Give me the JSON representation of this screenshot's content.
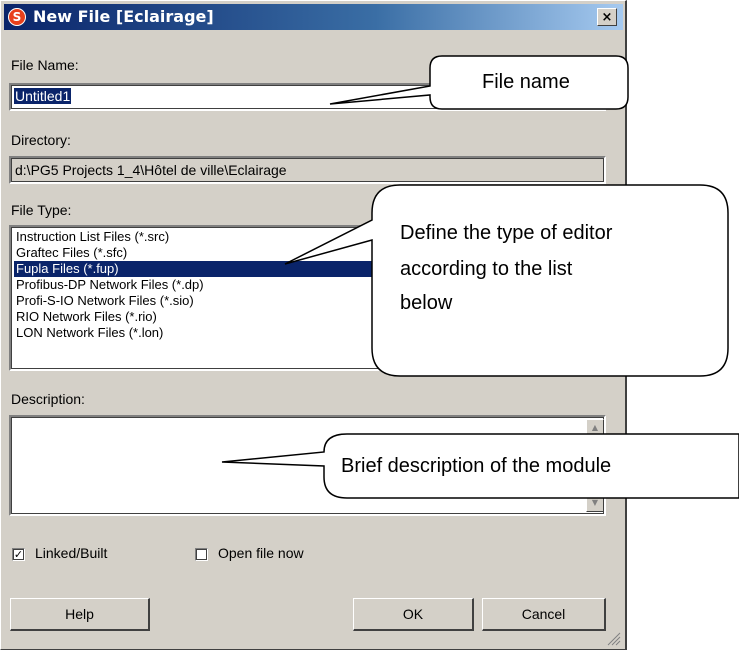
{
  "window": {
    "title": "New File [Eclairage]",
    "close_glyph": "×",
    "app_icon": "app-logo-icon"
  },
  "file_name": {
    "label": "File Name:",
    "value": "Untitled1"
  },
  "directory": {
    "label": "Directory:",
    "value": "d:\\PG5 Projects 1_4\\Hôtel de ville\\Eclairage"
  },
  "file_type": {
    "label": "File Type:",
    "items": [
      "Instruction List Files (*.src)",
      "Graftec Files (*.sfc)",
      "Fupla Files (*.fup)",
      "Profibus-DP Network Files (*.dp)",
      "Profi-S-IO Network Files (*.sio)",
      "RIO Network Files (*.rio)",
      "LON Network Files (*.lon)"
    ],
    "selected_index": 2
  },
  "description": {
    "label": "Description:",
    "value": ""
  },
  "options": {
    "linked_label": "Linked/Built",
    "linked_checked": true,
    "open_label": "Open file now",
    "open_checked": false,
    "check_glyph": "✓"
  },
  "buttons": {
    "help": "Help",
    "ok": "OK",
    "cancel": "Cancel"
  },
  "callouts": {
    "file_name": "File name",
    "file_type_line1": "Define the type of editor",
    "file_type_line2": "according to the list",
    "file_type_line3": "below",
    "description": "Brief description of the module"
  },
  "colors": {
    "dialog_face": "#d4d0c8",
    "selection": "#0a246a",
    "titlebar": "#0a246a"
  }
}
